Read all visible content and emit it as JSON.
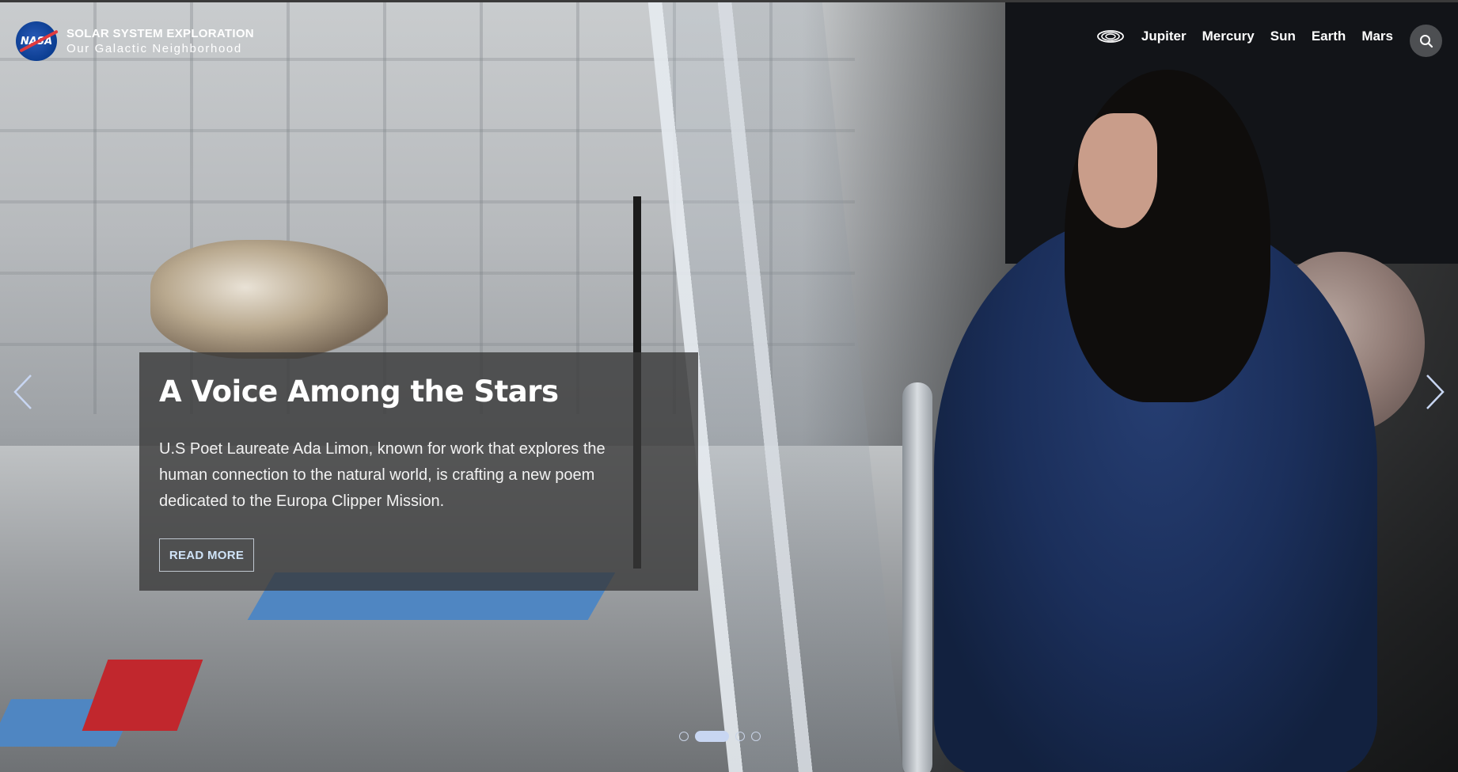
{
  "header": {
    "brand_title": "SOLAR SYSTEM EXPLORATION",
    "brand_subtitle": "Our Galactic Neighborhood",
    "logo_text": "NASA",
    "nav_items": [
      "Jupiter",
      "Mercury",
      "Sun",
      "Earth",
      "Mars"
    ],
    "nav_icon": "galaxy-icon",
    "search_icon": "search-icon"
  },
  "slide": {
    "title": "A Voice Among the Stars",
    "description": "U.S Poet Laureate Ada Limon, known for work that explores the human connection to the natural world, is crafting a new poem dedicated to the Europa Clipper Mission.",
    "cta_label": "READ MORE"
  },
  "carousel": {
    "prev_icon": "chevron-left-icon",
    "next_icon": "chevron-right-icon",
    "slide_count": 4,
    "active_index": 1
  },
  "colors": {
    "nasa_blue": "#0b3d91",
    "nasa_red": "#e03a3e",
    "cta_text": "#cfe3f7",
    "card_bg": "rgba(55,55,55,0.78)"
  }
}
